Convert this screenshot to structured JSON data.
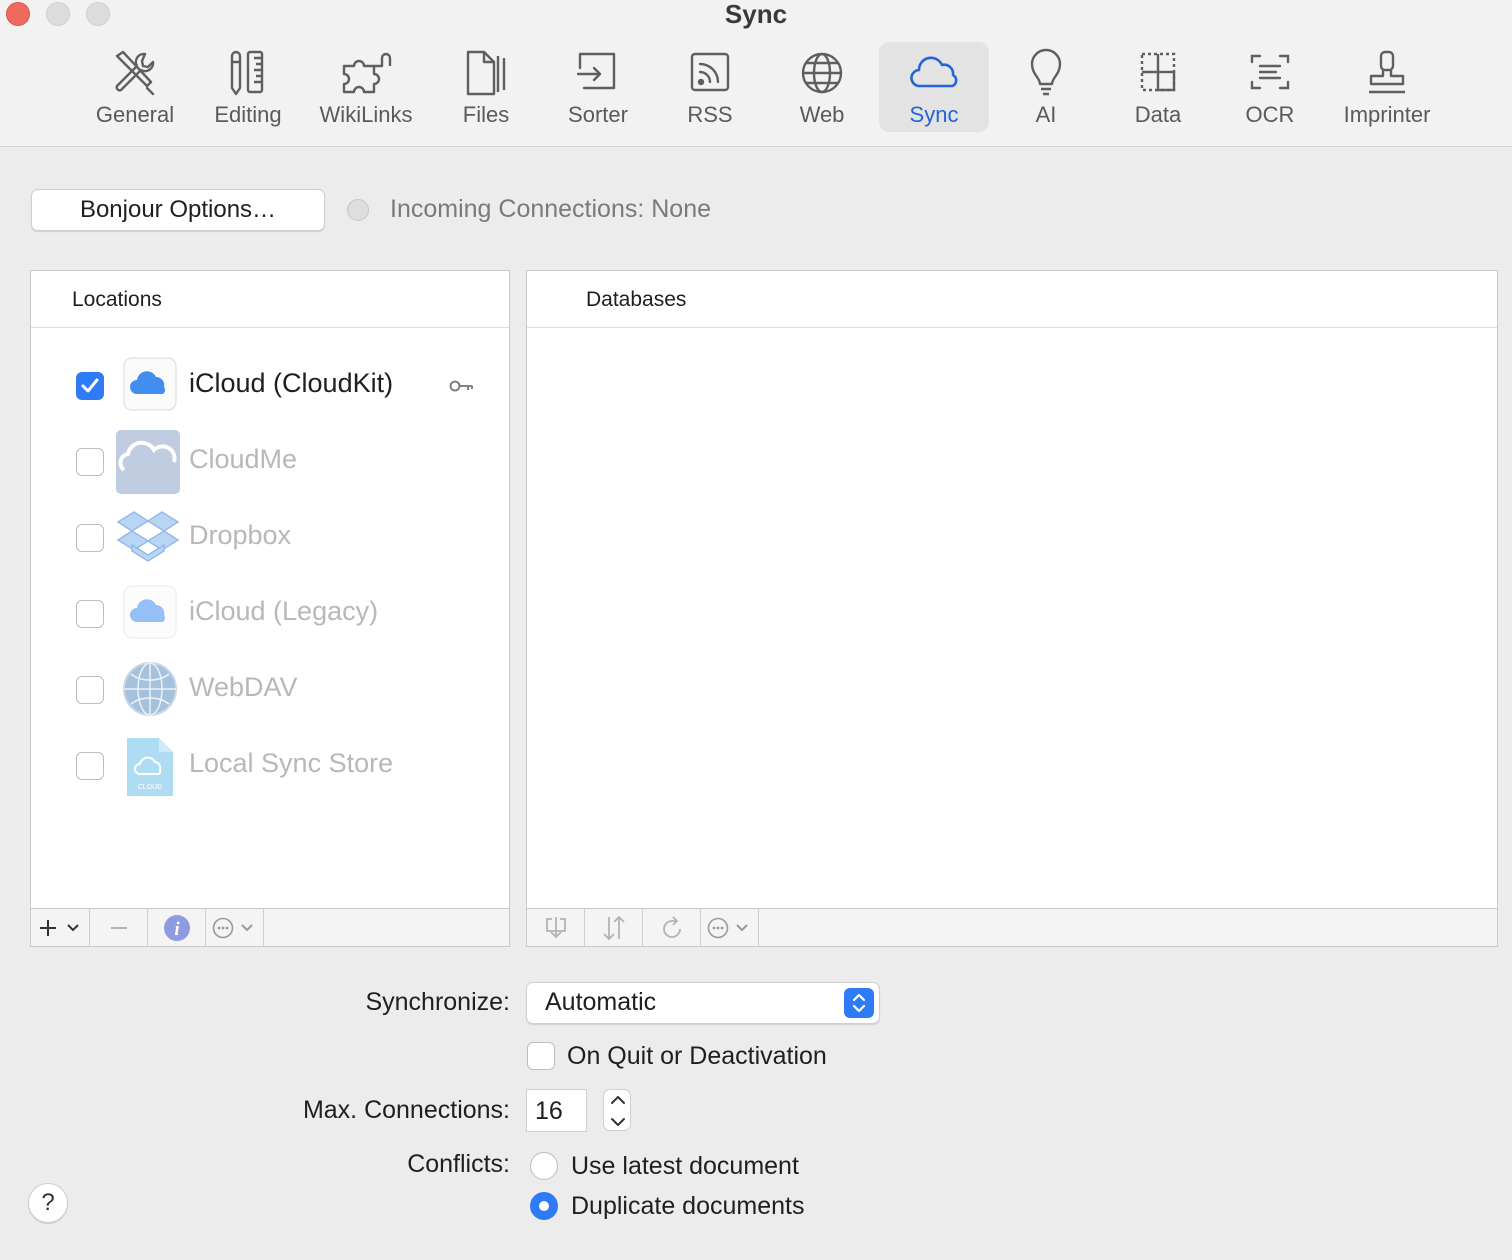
{
  "window": {
    "title": "Sync"
  },
  "toolbar": {
    "items": [
      {
        "label": "General",
        "icon": "tools-icon"
      },
      {
        "label": "Editing",
        "icon": "pencil-ruler-icon"
      },
      {
        "label": "WikiLinks",
        "icon": "puzzle-icon"
      },
      {
        "label": "Files",
        "icon": "files-icon"
      },
      {
        "label": "Sorter",
        "icon": "sorter-icon"
      },
      {
        "label": "RSS",
        "icon": "rss-icon"
      },
      {
        "label": "Web",
        "icon": "globe-icon"
      },
      {
        "label": "Sync",
        "icon": "cloud-icon",
        "selected": true
      },
      {
        "label": "AI",
        "icon": "lightbulb-icon"
      },
      {
        "label": "Data",
        "icon": "data-icon"
      },
      {
        "label": "OCR",
        "icon": "ocr-icon"
      },
      {
        "label": "Imprinter",
        "icon": "stamp-icon"
      }
    ]
  },
  "bonjour": {
    "button_label": "Bonjour Options…",
    "status_text": "Incoming Connections: None"
  },
  "locations": {
    "header": "Locations",
    "items": [
      {
        "name": "iCloud (CloudKit)",
        "checked": true,
        "enabled": true
      },
      {
        "name": "CloudMe",
        "checked": false,
        "enabled": false
      },
      {
        "name": "Dropbox",
        "checked": false,
        "enabled": false
      },
      {
        "name": "iCloud (Legacy)",
        "checked": false,
        "enabled": false
      },
      {
        "name": "WebDAV",
        "checked": false,
        "enabled": false
      },
      {
        "name": "Local Sync Store",
        "checked": false,
        "enabled": false
      }
    ],
    "local_icon_caption": "CLOUD"
  },
  "databases": {
    "header": "Databases"
  },
  "sync": {
    "synchronize_label": "Synchronize:",
    "synchronize_value": "Automatic",
    "on_quit_label": "On Quit or Deactivation",
    "max_connections_label": "Max. Connections:",
    "max_connections_value": "16",
    "conflicts_label": "Conflicts:",
    "conflict_options": [
      "Use latest document",
      "Duplicate documents"
    ],
    "conflict_selected": 1
  },
  "help": {
    "label": "?"
  },
  "colors": {
    "accent": "#2f7bf5",
    "close": "#ee6a5f"
  }
}
